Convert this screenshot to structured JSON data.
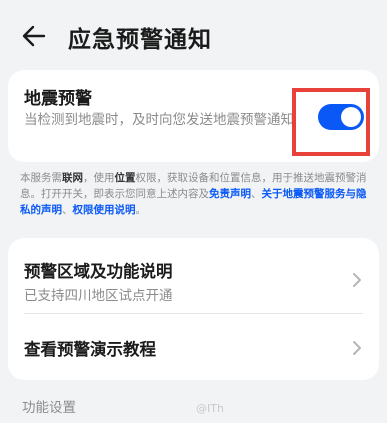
{
  "header": {
    "title": "应急预警通知",
    "back_icon": "back-arrow-icon"
  },
  "earthquake_card": {
    "title": "地震预警",
    "description": "当检测到地震时，及时向您发送地震预警通知",
    "toggle_on": true,
    "toggle_color": "#0a59f7",
    "highlight_color": "#e8413a"
  },
  "notice": {
    "p1": "本服务需",
    "network": "联网",
    "p2": "，使用",
    "location": "位置",
    "p3": "权限，获取设备和位置信息，用于推送地震预警消息。打开开关，即表示您同意上述内容及",
    "link_disclaimer": "免责声明",
    "p4": "、",
    "link_privacy": "关于地震预警服务与隐私的声明",
    "p5": "、",
    "link_permission": "权限使用说明",
    "p6": "。"
  },
  "menu": {
    "region_title": "预警区域及功能说明",
    "region_sub": "已支持四川地区试点开通",
    "tutorial_title": "查看预警演示教程",
    "chevron_icon": "chevron-right-icon"
  },
  "section_label": "功能设置",
  "watermark": "@ITh"
}
